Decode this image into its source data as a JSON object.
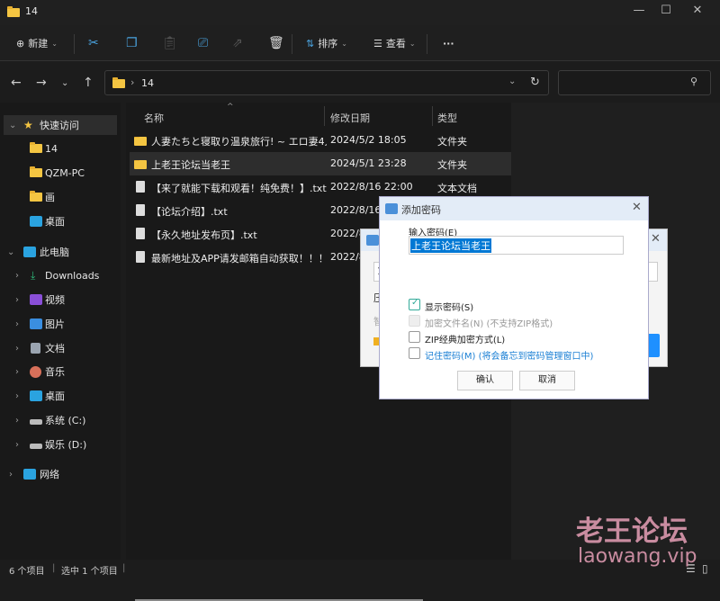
{
  "window": {
    "title": "14",
    "minimize": "—",
    "maximize": "☐",
    "close": "✕"
  },
  "toolbar": {
    "new_label": "新建",
    "sort_label": "排序",
    "view_label": "查看",
    "more": "···"
  },
  "address": {
    "path": "14",
    "separator": "›"
  },
  "sidebar": {
    "quick_access": "快速访问",
    "quick_items": [
      "14",
      "QZM-PC",
      "画",
      "桌面"
    ],
    "this_pc": "此电脑",
    "pc_items": [
      "Downloads",
      "视频",
      "图片",
      "文档",
      "音乐",
      "桌面",
      "系统 (C:)",
      "娱乐 (D:)"
    ],
    "network": "网络"
  },
  "files": {
    "columns": [
      "名称",
      "修改日期",
      "类型"
    ],
    "rows": [
      {
        "name": "人妻たちと寝取り温泉旅行! ~ エロ妻4人...",
        "date": "2024/5/2 18:05",
        "type": "文件夹",
        "kind": "folder"
      },
      {
        "name": "上老王论坛当老王",
        "date": "2024/5/1 23:28",
        "type": "文件夹",
        "kind": "folder"
      },
      {
        "name": "【来了就能下载和观看！纯免费！】.txt",
        "date": "2022/8/16 22:00",
        "type": "文本文档",
        "kind": "txt"
      },
      {
        "name": "【论坛介绍】.txt",
        "date": "2022/8/16",
        "type": "",
        "kind": "txt"
      },
      {
        "name": "【永久地址发布页】.txt",
        "date": "2022/8",
        "type": "",
        "kind": "txt"
      },
      {
        "name": "最新地址及APP请发邮箱自动获取！！！....",
        "date": "2022/8",
        "type": "",
        "kind": "txt"
      }
    ]
  },
  "status": {
    "count": "6 个项目",
    "selected": "选中 1 个项目"
  },
  "back_dialog": {
    "field_partial": "1",
    "label1": "压",
    "label2": "智"
  },
  "dialog": {
    "title": "添加密码",
    "input_label": "输入密码(E)",
    "password": "上老王论坛当老王",
    "options": [
      {
        "label": "显示密码(S)",
        "checked": true,
        "enabled": true
      },
      {
        "label": "加密文件名(N) (不支持ZIP格式)",
        "checked": false,
        "enabled": false
      },
      {
        "label": "ZIP经典加密方式(L)",
        "checked": false,
        "enabled": true
      },
      {
        "label": "记住密码(M) (将会备忘到密码管理窗口中)",
        "checked": false,
        "enabled": true
      }
    ],
    "ok": "确认",
    "cancel": "取消"
  },
  "watermark": {
    "cn": "老王论坛",
    "url": "laowang.vip"
  },
  "colors": {
    "accent": "#0078d4",
    "folder": "#f4c542",
    "link": "#1a7fd4"
  }
}
